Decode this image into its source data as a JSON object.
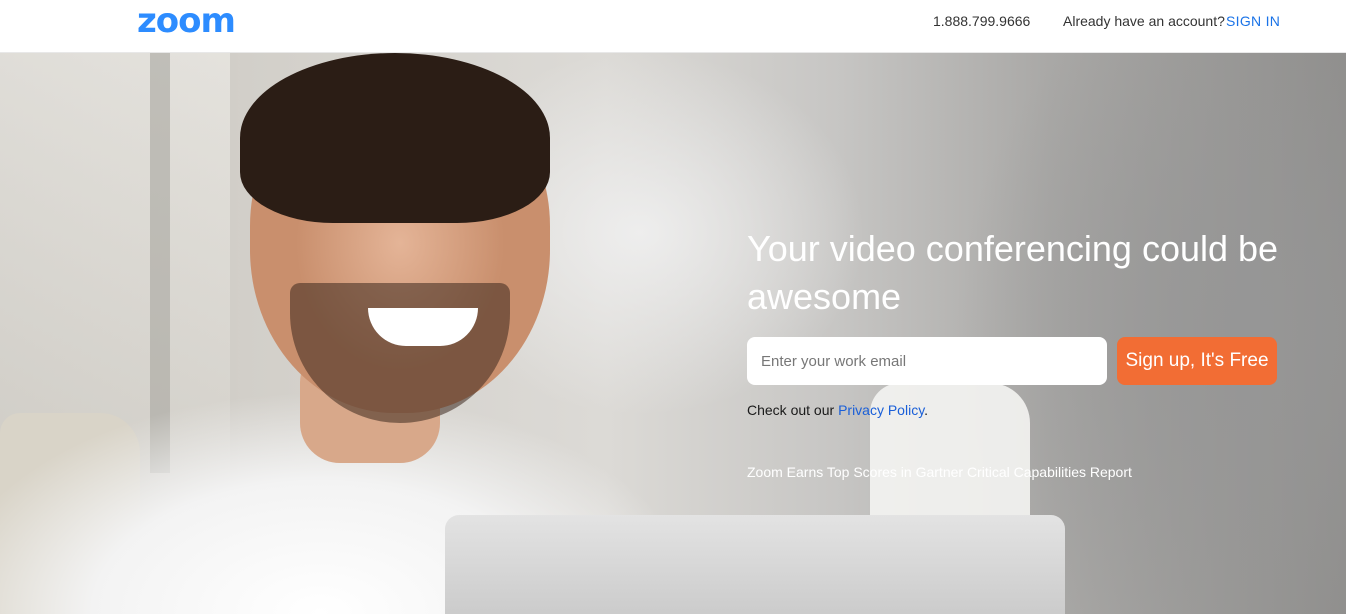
{
  "header": {
    "logo_text": "zoom",
    "phone": "1.888.799.9666",
    "account_prompt": "Already have an account?",
    "signin_label": "SIGN IN"
  },
  "hero": {
    "headline": "Your video conferencing could be awesome",
    "email_placeholder": "Enter your work email",
    "signup_label": "Sign up, It's Free",
    "privacy_prefix": "Check out our ",
    "privacy_link": "Privacy Policy",
    "privacy_suffix": ".",
    "gartner_link": "Zoom Earns Top Scores in Gartner Critical Capabilities Report"
  },
  "colors": {
    "brand_blue": "#2d8cff",
    "link_blue": "#1a73e8",
    "cta_orange": "#f26d34"
  }
}
